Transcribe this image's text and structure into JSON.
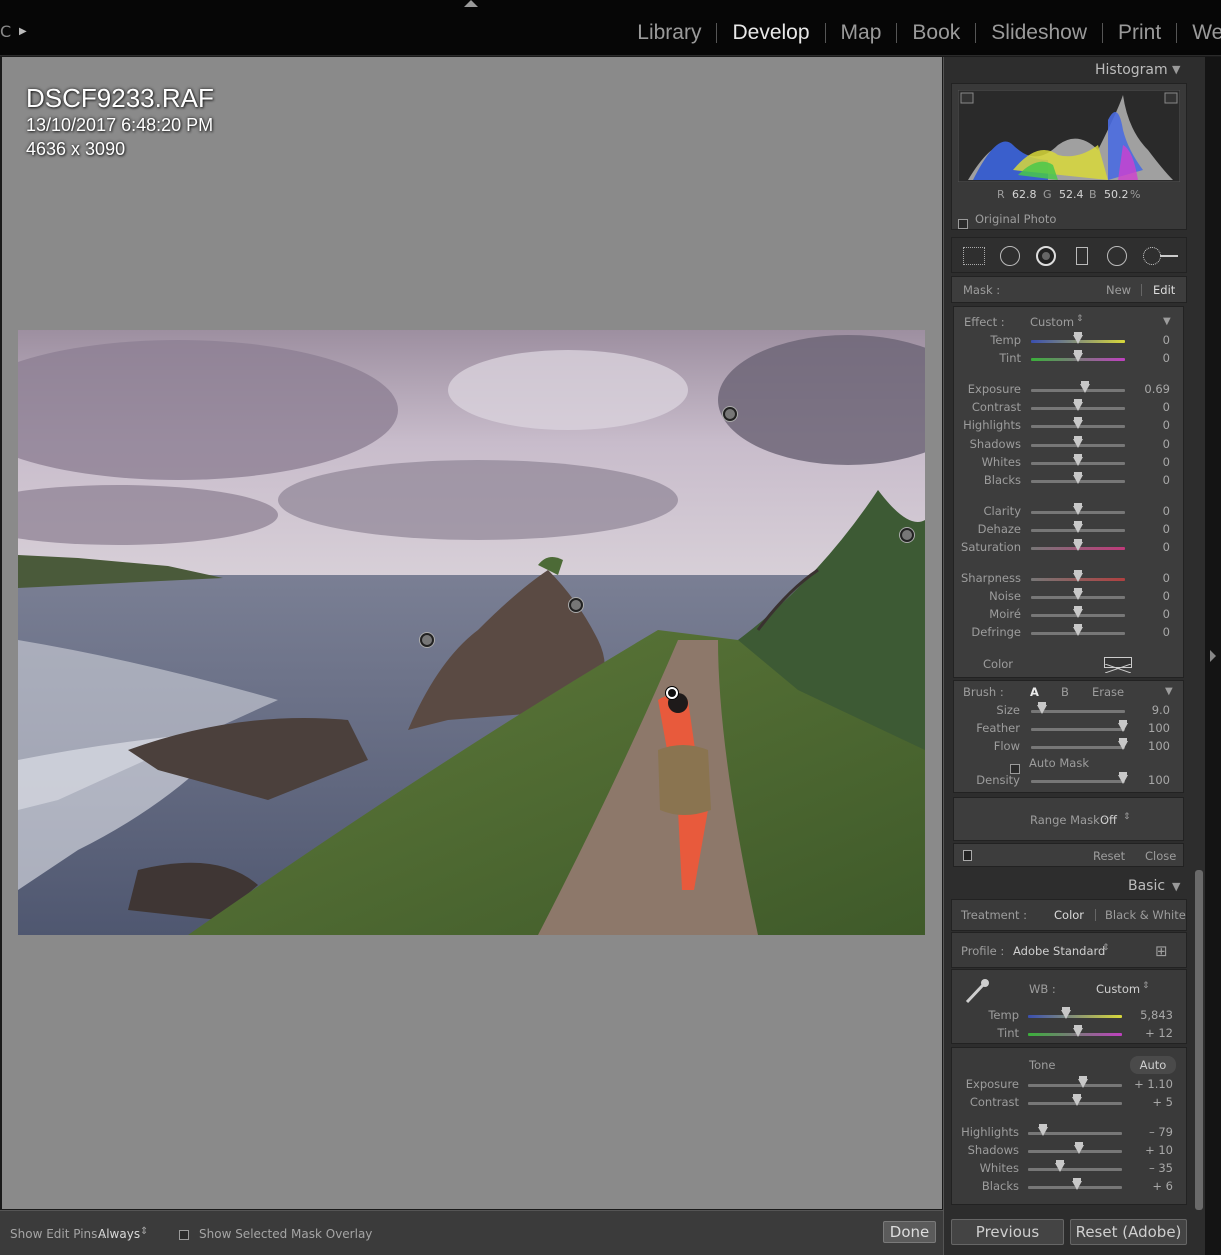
{
  "topbar": {
    "left_glyph": "C",
    "modules": [
      "Library",
      "Develop",
      "Map",
      "Book",
      "Slideshow",
      "Print",
      "Web"
    ],
    "active_module": "Develop"
  },
  "photo_info": {
    "filename": "DSCF9233.RAF",
    "datetime": "13/10/2017 6:48:20 PM",
    "dimensions": "4636 x 3090"
  },
  "toolbar": {
    "show_edit_pins_label": "Show Edit Pins :",
    "show_edit_pins_value": "Always",
    "mask_overlay_label": "Show Selected Mask Overlay",
    "done_label": "Done"
  },
  "histogram": {
    "title": "Histogram",
    "r_label": "R",
    "r_value": "62.8",
    "g_label": "G",
    "g_value": "52.4",
    "b_label": "B",
    "b_value": "50.2",
    "percent": "%",
    "original_photo_label": "Original Photo"
  },
  "mask": {
    "label": "Mask :",
    "new_label": "New",
    "edit_label": "Edit"
  },
  "effect": {
    "label": "Effect :",
    "preset": "Custom",
    "color_label": "Color",
    "sliders": [
      {
        "label": "Temp",
        "value": "0"
      },
      {
        "label": "Tint",
        "value": "0"
      },
      {
        "label": "Exposure",
        "value": "0.69"
      },
      {
        "label": "Contrast",
        "value": "0"
      },
      {
        "label": "Highlights",
        "value": "0"
      },
      {
        "label": "Shadows",
        "value": "0"
      },
      {
        "label": "Whites",
        "value": "0"
      },
      {
        "label": "Blacks",
        "value": "0"
      },
      {
        "label": "Clarity",
        "value": "0"
      },
      {
        "label": "Dehaze",
        "value": "0"
      },
      {
        "label": "Saturation",
        "value": "0"
      },
      {
        "label": "Sharpness",
        "value": "0"
      },
      {
        "label": "Noise",
        "value": "0"
      },
      {
        "label": "Moiré",
        "value": "0"
      },
      {
        "label": "Defringe",
        "value": "0"
      }
    ]
  },
  "brush": {
    "label": "Brush :",
    "a_label": "A",
    "b_label": "B",
    "erase_label": "Erase",
    "auto_mask_label": "Auto Mask",
    "sliders": [
      {
        "label": "Size",
        "value": "9.0"
      },
      {
        "label": "Feather",
        "value": "100"
      },
      {
        "label": "Flow",
        "value": "100"
      },
      {
        "label": "Density",
        "value": "100"
      }
    ],
    "range_mask_label": "Range Mask :",
    "range_mask_value": "Off",
    "reset_label": "Reset",
    "close_label": "Close"
  },
  "basic": {
    "title": "Basic",
    "treatment_label": "Treatment :",
    "treatment_color": "Color",
    "treatment_bw": "Black & White",
    "profile_label": "Profile :",
    "profile_value": "Adobe Standard",
    "wb_label": "WB :",
    "wb_value": "Custom",
    "tone_label": "Tone",
    "auto_label": "Auto",
    "sliders": [
      {
        "label": "Temp",
        "value": "5,843"
      },
      {
        "label": "Tint",
        "value": "+ 12"
      },
      {
        "label": "Exposure",
        "value": "+ 1.10"
      },
      {
        "label": "Contrast",
        "value": "+ 5"
      },
      {
        "label": "Highlights",
        "value": "– 79"
      },
      {
        "label": "Shadows",
        "value": "+ 10"
      },
      {
        "label": "Whites",
        "value": "– 35"
      },
      {
        "label": "Blacks",
        "value": "+ 6"
      }
    ]
  },
  "footer": {
    "previous_label": "Previous",
    "reset_label": "Reset (Adobe)"
  }
}
